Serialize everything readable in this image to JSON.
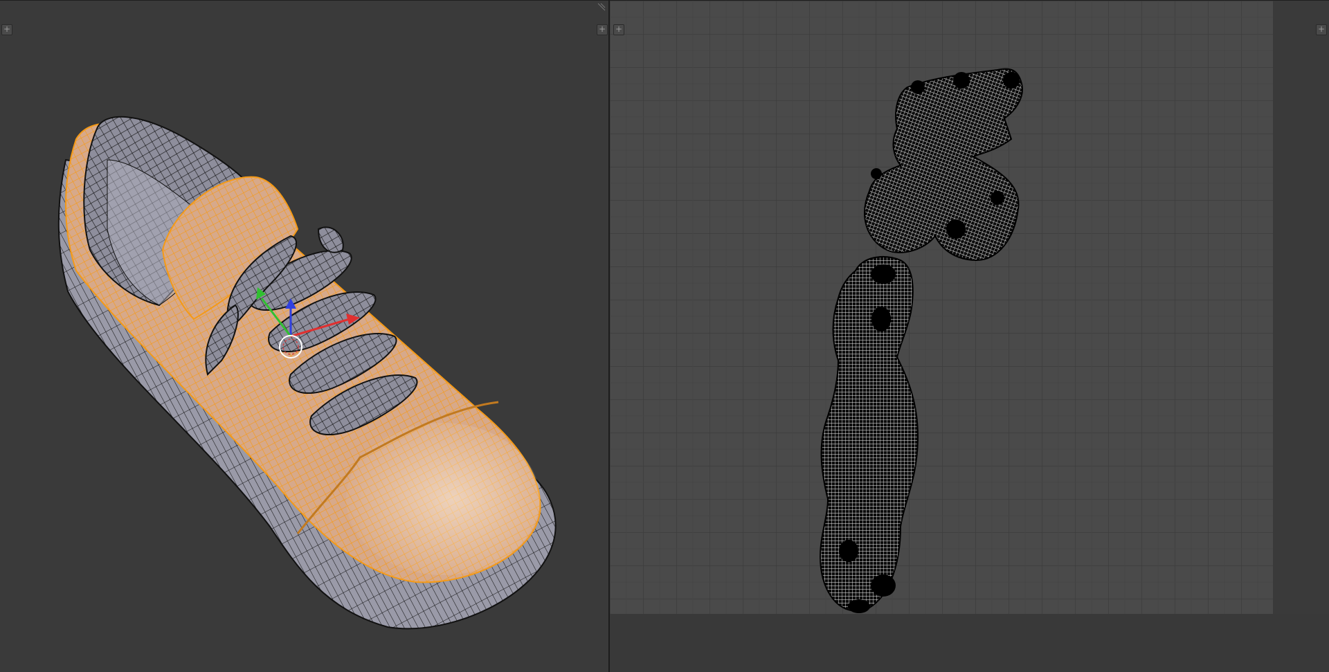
{
  "app": {
    "name": ""
  },
  "viewport3d": {
    "corner_widget_icon": "plus-icon",
    "grip_icon": "area-split-grip-icon",
    "object": "shoe-mesh",
    "selection_color": "#f59a16",
    "mesh_color": "#8c8c98",
    "wire_color": "#111111",
    "gizmo": {
      "x_color": "#e03030",
      "y_color": "#30c030",
      "z_color": "#3040e0"
    }
  },
  "uv_editor": {
    "corner_widget_icon": "plus-icon",
    "grid_color": "#4a4a4a",
    "grid_line_color": "#3a3a3a",
    "uv_wire_color": "#ffffff",
    "islands": [
      "uv-island-upper",
      "uv-island-sole"
    ]
  },
  "labels": {
    "plus": "+"
  }
}
